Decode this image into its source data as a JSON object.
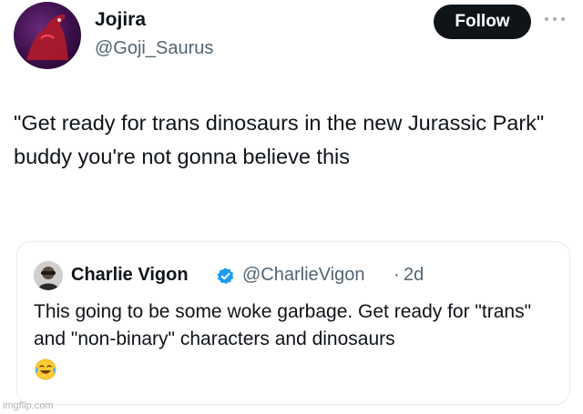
{
  "author": {
    "display_name": "Jojira",
    "handle": "@Goji_Saurus",
    "avatar_icon": "dinosaur-avatar-icon"
  },
  "follow_label": "Follow",
  "more_icon": "more-options-icon",
  "tweet_text": "\"Get ready for trans dinosaurs in the new Jurassic Park\" buddy you're not gonna believe this",
  "quote": {
    "display_name": "Charlie Vigon",
    "verified_icon": "verified-badge-icon",
    "handle": "@CharlieVigon",
    "separator": "·",
    "time": "2d",
    "text": "This going to be some woke garbage. Get ready for \"trans\" and \"non-binary\" characters and dinosaurs",
    "emoji_icon": "face-with-tears-of-joy-icon"
  },
  "watermark": "imgflip.com",
  "colors": {
    "follow_bg": "#0f1419",
    "verified": "#1d9bf0",
    "secondary_text": "#536471"
  }
}
